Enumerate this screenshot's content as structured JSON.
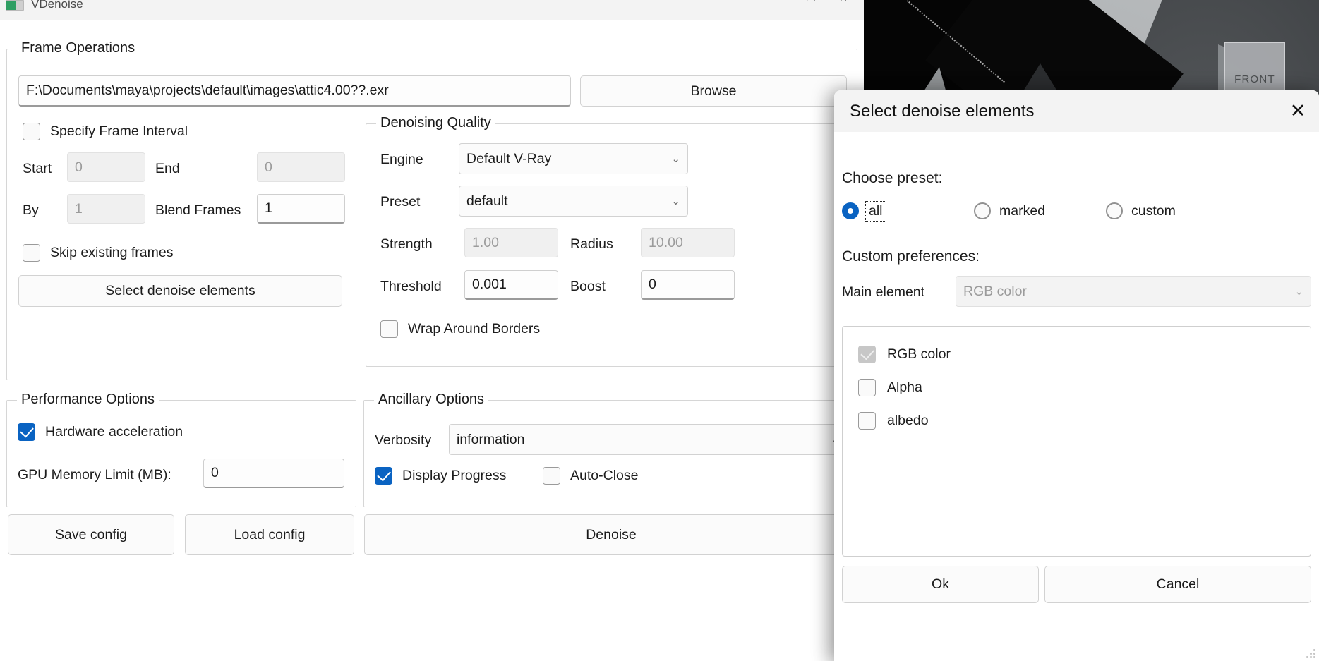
{
  "window": {
    "title": "VDenoise",
    "icon": "vray-app-icon",
    "minimize_label": "—",
    "maximize_label": "❐",
    "close_label": "✕"
  },
  "frame_operations": {
    "legend": "Frame Operations",
    "path_value": "F:\\Documents\\maya\\projects\\default\\images\\attic4.00??.exr",
    "browse_label": "Browse",
    "specify_frame_interval": {
      "label": "Specify Frame Interval",
      "checked": false
    },
    "start_label": "Start",
    "start_value": "0",
    "end_label": "End",
    "end_value": "0",
    "by_label": "By",
    "by_value": "1",
    "blend_frames_label": "Blend Frames",
    "blend_frames_value": "1",
    "skip_existing_frames": {
      "label": "Skip existing frames",
      "checked": false
    },
    "select_elements_label": "Select denoise elements"
  },
  "denoising_quality": {
    "legend": "Denoising Quality",
    "engine_label": "Engine",
    "engine_value": "Default V-Ray",
    "preset_label": "Preset",
    "preset_value": "default",
    "strength_label": "Strength",
    "strength_value": "1.00",
    "radius_label": "Radius",
    "radius_value": "10.00",
    "threshold_label": "Threshold",
    "threshold_value": "0.001",
    "boost_label": "Boost",
    "boost_value": "0",
    "wrap_around_borders": {
      "label": "Wrap Around Borders",
      "checked": false
    },
    "chevron": "⌄"
  },
  "performance_options": {
    "legend": "Performance Options",
    "hardware_acceleration": {
      "label": "Hardware acceleration",
      "checked": true
    },
    "gpu_memory_label": "GPU Memory Limit (MB):",
    "gpu_memory_value": "0"
  },
  "ancillary_options": {
    "legend": "Ancillary Options",
    "verbosity_label": "Verbosity",
    "verbosity_value": "information",
    "display_progress": {
      "label": "Display Progress",
      "checked": true
    },
    "auto_close": {
      "label": "Auto-Close",
      "checked": false
    },
    "chevron": "⌄"
  },
  "footer": {
    "save_config_label": "Save config",
    "load_config_label": "Load config",
    "denoise_label": "Denoise"
  },
  "modal": {
    "title": "Select denoise elements",
    "close_label": "✕",
    "choose_preset_label": "Choose preset:",
    "presets": [
      {
        "label": "all",
        "selected": true,
        "focused": true
      },
      {
        "label": "marked",
        "selected": false,
        "focused": false
      },
      {
        "label": "custom",
        "selected": false,
        "focused": false
      }
    ],
    "custom_preferences_label": "Custom preferences:",
    "main_element_label": "Main element",
    "main_element_value": "RGB color",
    "main_element_chevron": "⌄",
    "elements": [
      {
        "label": "RGB color",
        "checked": true,
        "disabled": true
      },
      {
        "label": "Alpha",
        "checked": false,
        "disabled": false
      },
      {
        "label": "albedo",
        "checked": false,
        "disabled": false
      }
    ],
    "ok_label": "Ok",
    "cancel_label": "Cancel"
  },
  "viewport": {
    "view_cube_label": "FRONT"
  },
  "colors": {
    "accent": "#0a63c2",
    "window_bg": "#ffffff",
    "titlebar_bg": "#f3f3f3",
    "border": "#d6d6d6",
    "disabled_text": "#9b9b9b"
  }
}
